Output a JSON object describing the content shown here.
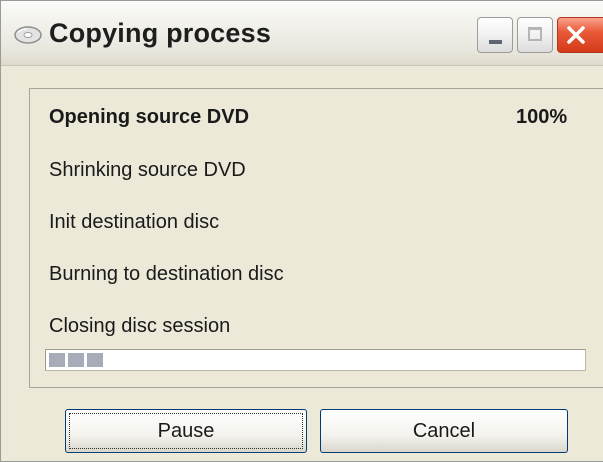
{
  "window": {
    "title": "Copying process",
    "controls": {
      "minimize": "minimize",
      "maximize": "maximize",
      "close": "close"
    }
  },
  "steps": [
    {
      "label": "Opening source DVD",
      "active": true
    },
    {
      "label": "Shrinking source DVD",
      "active": false
    },
    {
      "label": "Init destination disc",
      "active": false
    },
    {
      "label": "Burning to destination disc",
      "active": false
    },
    {
      "label": "Closing disc session",
      "active": false
    }
  ],
  "current_step_percent": "100%",
  "progress": {
    "blocks_filled": 3,
    "fraction": 0.11
  },
  "buttons": {
    "pause": "Pause",
    "cancel": "Cancel"
  },
  "colors": {
    "close_button": "#D33B1A",
    "progress_block": "#A8ABB8",
    "window_bg": "#ECE9D8"
  },
  "icons": [
    "disc-app-icon",
    "minimize-icon",
    "maximize-icon",
    "close-icon"
  ]
}
